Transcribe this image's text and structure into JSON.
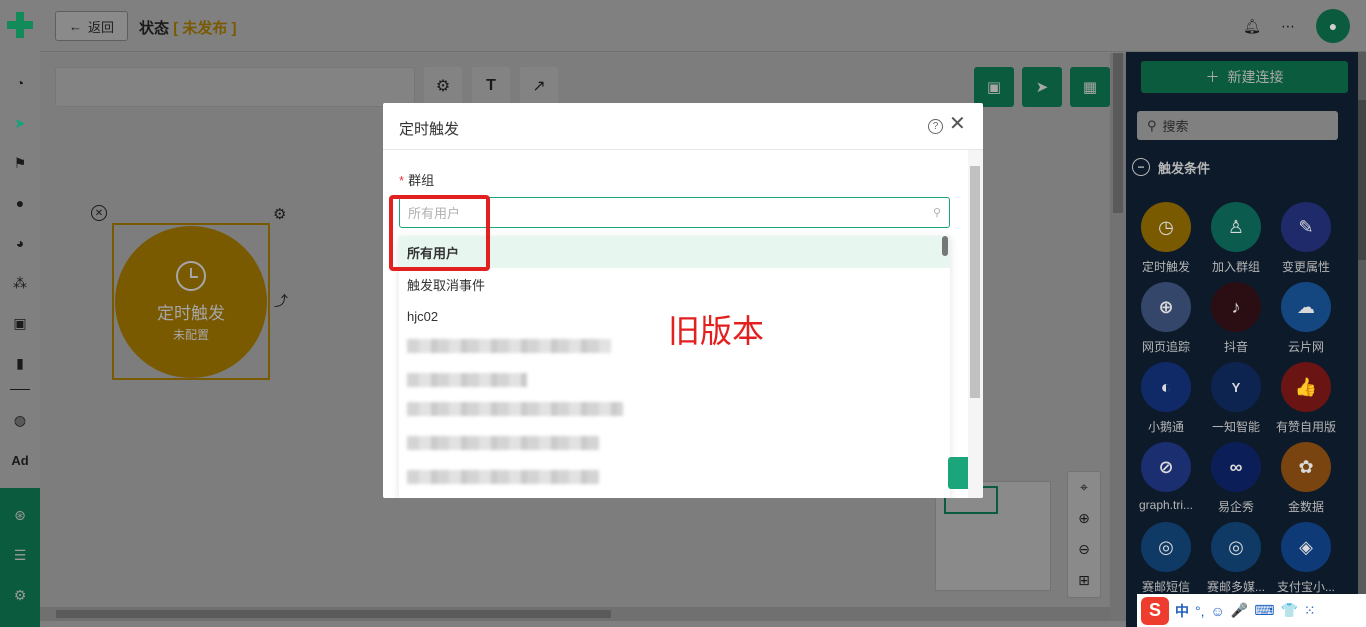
{
  "sidebar": {
    "items": [
      {
        "icon": "dashboard-icon",
        "glyph": "◔",
        "active": false
      },
      {
        "icon": "send-icon",
        "glyph": "➤",
        "active": true
      },
      {
        "icon": "flag-icon",
        "glyph": "⚑",
        "active": false
      },
      {
        "icon": "user-icon",
        "glyph": "●",
        "active": false
      },
      {
        "icon": "users-icon",
        "glyph": "◕",
        "active": false
      },
      {
        "icon": "cluster-icon",
        "glyph": "⁂",
        "active": false
      },
      {
        "icon": "bookmark-icon",
        "glyph": "▣",
        "active": false
      },
      {
        "icon": "bar-chart-icon",
        "glyph": "▮",
        "active": false
      },
      {
        "icon": "wechat-icon",
        "glyph": "◍",
        "active": false
      },
      {
        "icon": "ad-icon",
        "glyph": "Ad",
        "active": false
      }
    ],
    "bottom_items": [
      {
        "icon": "network-icon",
        "glyph": "⊛"
      },
      {
        "icon": "server-icon",
        "glyph": "☰"
      },
      {
        "icon": "settings-icon",
        "glyph": "⚙"
      }
    ]
  },
  "header": {
    "back_label": "返回",
    "title": "状态",
    "status_open": "[",
    "status": "未发布",
    "status_close": "]"
  },
  "canvas": {
    "node": {
      "label": "定时触发",
      "sublabel": "未配置"
    }
  },
  "right_panel": {
    "new_connection": "新建连接",
    "search_placeholder": "搜索",
    "section_title": "触发条件",
    "tiles": [
      {
        "label": "定时触发",
        "color": "#7a5a00",
        "glyph": "◷"
      },
      {
        "label": "加入群组",
        "color": "#0b5c4f",
        "glyph": "♙"
      },
      {
        "label": "变更属性",
        "color": "#1e2a6a",
        "glyph": "✎"
      },
      {
        "label": "网页追踪",
        "color": "#34466a",
        "glyph": "⊕"
      },
      {
        "label": "抖音",
        "color": "#2a0e14",
        "glyph": "♪"
      },
      {
        "label": "云片网",
        "color": "#144680",
        "glyph": "☁"
      },
      {
        "label": "小鹅通",
        "color": "#102a68",
        "glyph": "◐"
      },
      {
        "label": "一知智能",
        "color": "#0e2450",
        "glyph": "Y"
      },
      {
        "label": "有赞自用版",
        "color": "#6a1414",
        "glyph": "👍"
      },
      {
        "label": "graph.tri...",
        "color": "#1a2e70",
        "glyph": "⊘"
      },
      {
        "label": "易企秀",
        "color": "#0c1e58",
        "glyph": "∞"
      },
      {
        "label": "金数据",
        "color": "#7a4410",
        "glyph": "✿"
      },
      {
        "label": "赛邮短信",
        "color": "#0f3a66",
        "glyph": "◎"
      },
      {
        "label": "赛邮多媒...",
        "color": "#0f3a66",
        "glyph": "◎"
      },
      {
        "label": "支付宝小...",
        "color": "#0e3a78",
        "glyph": "◈"
      }
    ]
  },
  "ime": {
    "logo": "S",
    "lang": "中",
    "punct": "°,",
    "items": [
      "☺",
      "🎤",
      "⌨",
      "👕",
      "⁙"
    ]
  },
  "modal": {
    "title": "定时触发",
    "field_label": "群组",
    "required_mark": "*",
    "select_placeholder": "所有用户",
    "options": [
      "所有用户",
      "触发取消事件",
      "hjc02"
    ],
    "selected_index": 0
  },
  "annotation": {
    "text": "旧版本",
    "color": "#e32020"
  }
}
